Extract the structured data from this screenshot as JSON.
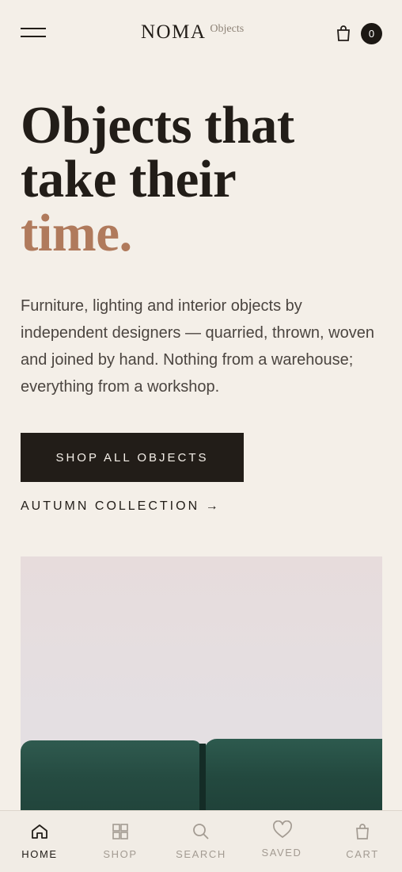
{
  "header": {
    "brand": "NOMA",
    "brand_sub": "Objects",
    "cart_count": "0"
  },
  "hero": {
    "title_line1": "Objects that",
    "title_line2": "take their",
    "title_accent": "time.",
    "description": "Furniture, lighting and interior objects by independent designers — quarried, thrown, woven and joined by hand. Nothing from a warehouse; everything from a workshop.",
    "primary_cta": "SHOP ALL OBJECTS",
    "secondary_link": "AUTUMN COLLECTION →"
  },
  "bottom_nav": {
    "items": [
      {
        "label": "HOME",
        "icon": "home-icon",
        "active": true
      },
      {
        "label": "SHOP",
        "icon": "grid-icon",
        "active": false
      },
      {
        "label": "SEARCH",
        "icon": "search-icon",
        "active": false
      },
      {
        "label": "SAVED",
        "icon": "heart-icon",
        "active": false
      },
      {
        "label": "CART",
        "icon": "bag-icon",
        "active": false
      }
    ]
  },
  "colors": {
    "background": "#f4efe8",
    "text": "#221d18",
    "accent": "#b07a5c",
    "muted": "#a39b92"
  }
}
